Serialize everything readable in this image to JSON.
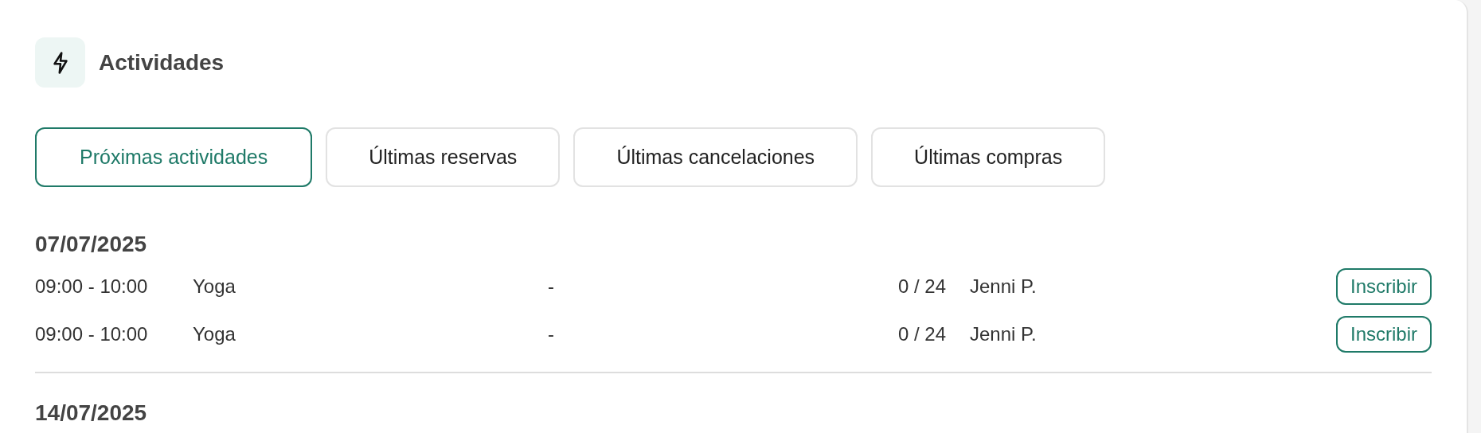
{
  "header": {
    "title": "Actividades"
  },
  "tabs": [
    {
      "label": "Próximas actividades",
      "selected": true
    },
    {
      "label": "Últimas reservas",
      "selected": false
    },
    {
      "label": "Últimas cancelaciones",
      "selected": false
    },
    {
      "label": "Últimas compras",
      "selected": false
    }
  ],
  "days": [
    {
      "date": "07/07/2025",
      "activities": [
        {
          "time": "09:00 - 10:00",
          "name": "Yoga",
          "room": "-",
          "occupancy": "0 / 24",
          "instructor": "Jenni P.",
          "action": "Inscribir"
        },
        {
          "time": "09:00 - 10:00",
          "name": "Yoga",
          "room": "-",
          "occupancy": "0 / 24",
          "instructor": "Jenni P.",
          "action": "Inscribir"
        }
      ]
    },
    {
      "date": "14/07/2025"
    }
  ]
}
